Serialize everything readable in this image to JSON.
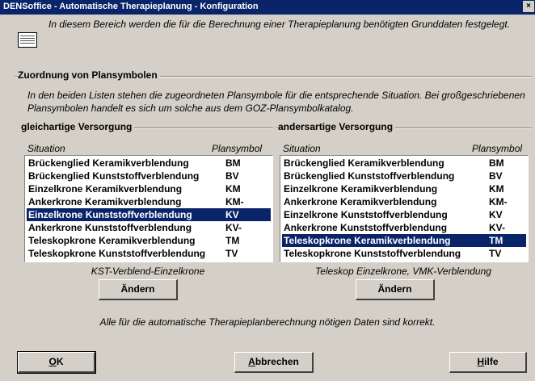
{
  "window": {
    "title": "DENSoffice - Automatische Therapieplanung - Konfiguration",
    "close_label": "×"
  },
  "intro": {
    "text": "In diesem Bereich werden die für die Berechnung einer Therapieplanung benötigten Grunddaten festgelegt.",
    "icon": "document-icon"
  },
  "section": {
    "title": "Zuordnung von Plansymbolen",
    "description": "In den beiden Listen stehen die zugeordneten Plansymbole für die entsprechende Situation. Bei großgeschriebenen Plansymbolen handelt es sich um solche aus dem GOZ-Plansymbolkatalog."
  },
  "left": {
    "title": "gleichartige Versorgung",
    "col_situation": "Situation",
    "col_symbol": "Plansymbol",
    "items": [
      {
        "name": "Brückenglied Keramikverblendung",
        "code": "BM"
      },
      {
        "name": "Brückenglied Kunststoffverblendung",
        "code": "BV"
      },
      {
        "name": "Einzelkrone Keramikverblendung",
        "code": "KM"
      },
      {
        "name": "Ankerkrone Keramikverblendung",
        "code": "KM-"
      },
      {
        "name": "Einzelkrone Kunststoffverblendung",
        "code": "KV"
      },
      {
        "name": "Ankerkrone Kunststoffverblendung",
        "code": "KV-"
      },
      {
        "name": "Teleskopkrone Keramikverblendung",
        "code": "TM"
      },
      {
        "name": "Teleskopkrone Kunststoffverblendung",
        "code": "TV"
      }
    ],
    "selected_index": 4,
    "caption": "KST-Verblend-Einzelkrone",
    "button": "Ändern"
  },
  "right": {
    "title": "andersartige Versorgung",
    "col_situation": "Situation",
    "col_symbol": "Plansymbol",
    "items": [
      {
        "name": "Brückenglied Keramikverblendung",
        "code": "BM"
      },
      {
        "name": "Brückenglied Kunststoffverblendung",
        "code": "BV"
      },
      {
        "name": "Einzelkrone Keramikverblendung",
        "code": "KM"
      },
      {
        "name": "Ankerkrone Keramikverblendung",
        "code": "KM-"
      },
      {
        "name": "Einzelkrone Kunststoffverblendung",
        "code": "KV"
      },
      {
        "name": "Ankerkrone Kunststoffverblendung",
        "code": "KV-"
      },
      {
        "name": "Teleskopkrone Keramikverblendung",
        "code": "TM"
      },
      {
        "name": "Teleskopkrone Kunststoffverblendung",
        "code": "TV"
      }
    ],
    "selected_index": 6,
    "caption": "Teleskop Einzelkrone, VMK-Verblendung",
    "button": "Ändern"
  },
  "status": "Alle für die automatische Therapieplanberechnung nötigen Daten sind korrekt.",
  "buttons": {
    "ok": {
      "accel": "O",
      "rest": "K"
    },
    "cancel": {
      "accel": "A",
      "rest": "bbrechen"
    },
    "help": {
      "accel": "H",
      "rest": "ilfe"
    }
  },
  "colors": {
    "titlebar": "#0a246a",
    "face": "#d4d0c8",
    "selection": "#0a246a"
  }
}
